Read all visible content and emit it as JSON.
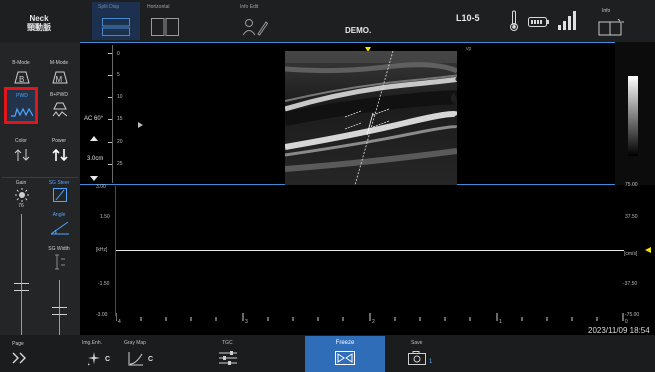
{
  "topbar": {
    "preset_line1": "Neck",
    "preset_line2": "頸動脈",
    "split_disp": "Split Disp",
    "horizontal": "Horizontal",
    "info_edit": "Info Edit",
    "demo": "DEMO.",
    "probe": "L10-5",
    "info": "Info"
  },
  "sidebar": {
    "bmode": "B-Mode",
    "mmode": "M-Mode",
    "pwd": "PWD",
    "bpwd": "B+PWD",
    "color": "Color",
    "power": "Power",
    "gain": "Gain",
    "gain_value": "76",
    "sg_steer": "SG Steer",
    "angle": "Angle",
    "sg_width": "SG Width",
    "page": "Page"
  },
  "image": {
    "depth_ticks": [
      "0",
      "5",
      "10",
      "15",
      "20",
      "25"
    ],
    "ac_angle": "AC 60°",
    "depth_value": "3.0cm",
    "vp_label": "vp"
  },
  "doppler": {
    "left_scale": [
      "3.00",
      "1.50",
      "[kHz]",
      "-1.50",
      "-3.00"
    ],
    "right_scale": [
      "75.00",
      "37.50",
      "[cm/s]",
      "-37.50",
      "-75.00"
    ],
    "time_labels": [
      "4",
      "3",
      "2",
      "1",
      "0"
    ],
    "timestamp": "2023/11/09 18:54"
  },
  "bottombar": {
    "img_enh": "Img.Enh.",
    "img_enh_letter": "C",
    "gray_map": "Gray Map",
    "gray_map_letter": "C",
    "tgc": "TGC",
    "freeze": "Freeze",
    "save": "Save",
    "save_count": "1"
  },
  "colors": {
    "accent_blue": "#3f8fd8",
    "highlight_red": "#e0161b",
    "marker_yellow": "#f2e600",
    "background": "#000000"
  }
}
